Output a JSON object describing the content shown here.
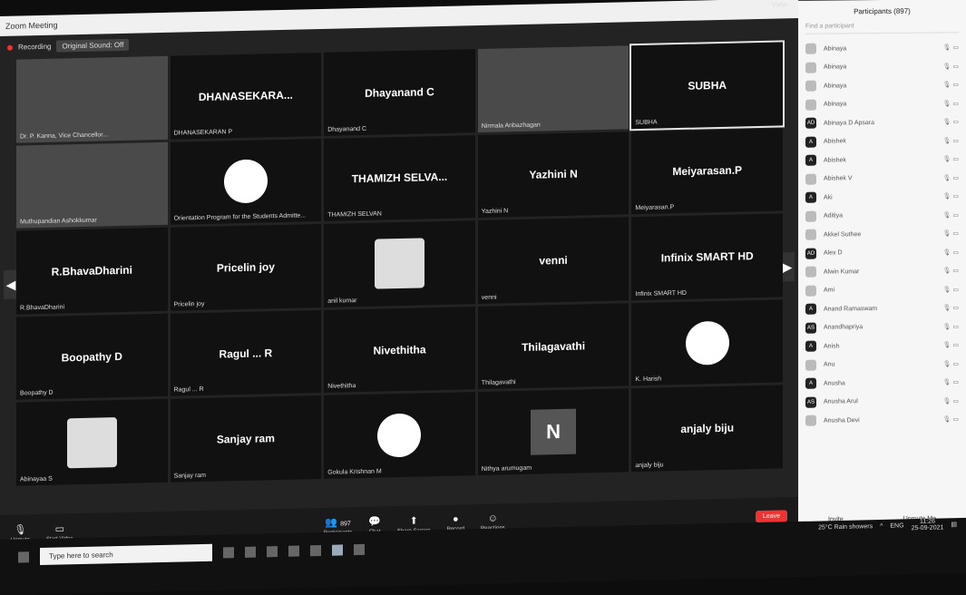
{
  "window": {
    "title": "Zoom Meeting",
    "view_label": "View"
  },
  "top_bar": {
    "recording_label": "Recording",
    "sound_label": "Original Sound: Off"
  },
  "tiles": [
    {
      "center": "",
      "name": "Dr. P. Kanna, Vice Chancellor...",
      "type": "video"
    },
    {
      "center": "DHANASEKARA...",
      "name": "DHANASEKARAN P",
      "type": "name"
    },
    {
      "center": "Dhayanand C",
      "name": "Dhayanand C",
      "type": "name"
    },
    {
      "center": "",
      "name": "Nirmala Anbazhagan",
      "type": "video"
    },
    {
      "center": "SUBHA",
      "name": "SUBHA",
      "type": "name",
      "active": true
    },
    {
      "center": "",
      "name": "Muthupandian Ashokkumar",
      "type": "video"
    },
    {
      "center": "",
      "name": "Orientation Program for the Students Admitte...",
      "type": "logo"
    },
    {
      "center": "THAMIZH SELVA...",
      "name": "THAMIZH SELVAN",
      "type": "name"
    },
    {
      "center": "Yazhini N",
      "name": "Yazhini N",
      "type": "name"
    },
    {
      "center": "Meiyarasan.P",
      "name": "Meiyarasan.P",
      "type": "name"
    },
    {
      "center": "R.BhavaDharini",
      "name": "R.BhavaDharini",
      "type": "name"
    },
    {
      "center": "Pricelin joy",
      "name": "Pricelin joy",
      "type": "name"
    },
    {
      "center": "",
      "name": "anil kumar",
      "type": "avatar"
    },
    {
      "center": "venni",
      "name": "venni",
      "type": "name"
    },
    {
      "center": "Infinix SMART HD",
      "name": "Infinix SMART HD",
      "type": "name"
    },
    {
      "center": "Boopathy D",
      "name": "Boopathy D",
      "type": "name"
    },
    {
      "center": "Ragul ... R",
      "name": "Ragul ... R",
      "type": "name"
    },
    {
      "center": "Nivethitha",
      "name": "Nivethitha",
      "type": "name"
    },
    {
      "center": "Thilagavathi",
      "name": "Thilagavathi",
      "type": "name"
    },
    {
      "center": "",
      "name": "K. Harish",
      "type": "logo"
    },
    {
      "center": "",
      "name": "Abinayaa S",
      "type": "avatar"
    },
    {
      "center": "Sanjay ram",
      "name": "Sanjay ram",
      "type": "name"
    },
    {
      "center": "",
      "name": "Gokula Krishnan M",
      "type": "logo"
    },
    {
      "center": "N",
      "name": "Nithya arumugam",
      "type": "letter"
    },
    {
      "center": "anjaly biju",
      "name": "anjaly biju",
      "type": "name"
    }
  ],
  "toolbar": {
    "unmute": "Unmute",
    "start_video": "Start Video",
    "participants": "Participants",
    "participants_count": "897",
    "chat": "Chat",
    "share_screen": "Share Screen",
    "record": "Record",
    "reactions": "Reactions",
    "end": "Leave"
  },
  "participants_panel": {
    "title": "Participants (897)",
    "search_placeholder": "Find a participant",
    "items": [
      {
        "initials": "",
        "name": "Abinaya"
      },
      {
        "initials": "",
        "name": "Abinaya"
      },
      {
        "initials": "",
        "name": "Abinaya"
      },
      {
        "initials": "",
        "name": "Abinaya"
      },
      {
        "initials": "AD",
        "name": "Abinaya D Apsara"
      },
      {
        "initials": "A",
        "name": "Abishek"
      },
      {
        "initials": "A",
        "name": "Abishek"
      },
      {
        "initials": "",
        "name": "Abishek V"
      },
      {
        "initials": "A",
        "name": "Aki"
      },
      {
        "initials": "",
        "name": "Aditiya"
      },
      {
        "initials": "",
        "name": "Akkel Suthee"
      },
      {
        "initials": "AD",
        "name": "Alex D"
      },
      {
        "initials": "",
        "name": "Alwin Kumar"
      },
      {
        "initials": "",
        "name": "Ami"
      },
      {
        "initials": "A",
        "name": "Anand Ramaswam"
      },
      {
        "initials": "AS",
        "name": "Anandhapriya"
      },
      {
        "initials": "A",
        "name": "Anish"
      },
      {
        "initials": "",
        "name": "Anu"
      },
      {
        "initials": "A",
        "name": "Anusha"
      },
      {
        "initials": "AS",
        "name": "Anusha Arul"
      },
      {
        "initials": "",
        "name": "Anusha Devi"
      }
    ],
    "invite": "Invite",
    "unmute_me": "Unmute Me"
  },
  "taskbar": {
    "search_placeholder": "Type here to search",
    "weather": "25°C Rain showers",
    "lang": "ENG",
    "time": "11:26",
    "date": "25-09-2021"
  }
}
